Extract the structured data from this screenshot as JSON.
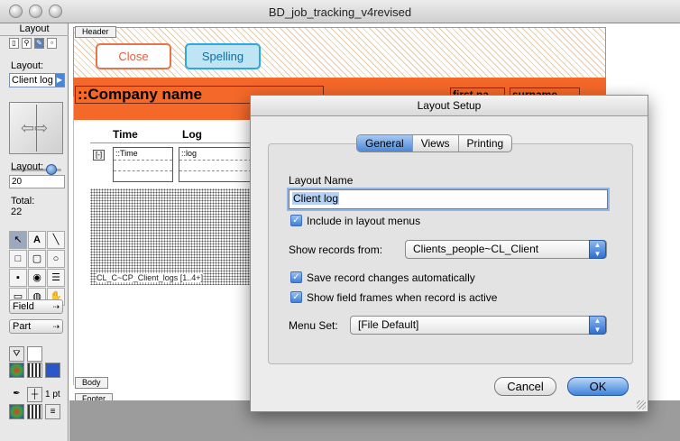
{
  "window": {
    "title": "BD_job_tracking_v4revised"
  },
  "palette": {
    "title": "Layout",
    "layout_label": "Layout:",
    "layout_popup": "Client log",
    "layout_num_label": "Layout:",
    "layout_num": "20",
    "total_label": "Total:",
    "total_value": "22",
    "field_button": "Field",
    "part_button": "Part",
    "line_width": "1 pt"
  },
  "canvas": {
    "header_tab": "Header",
    "body_tab": "Body",
    "footer_tab": "Footer",
    "close_button": "Close",
    "spelling_button": "Spelling",
    "company_field": "::Company name",
    "first_name_field": "first na",
    "surname_field": "surname",
    "col_time": "Time",
    "col_log": "Log",
    "portal_time": "::Time",
    "portal_log": "::log",
    "portal_minus": "[-]",
    "portal_label": "CL_C~CP_Client_logs [1..4+]"
  },
  "dialog": {
    "title": "Layout Setup",
    "tabs": [
      "General",
      "Views",
      "Printing"
    ],
    "layout_name_label": "Layout Name",
    "layout_name_value": "Client log",
    "include_menus_label": "Include in layout menus",
    "show_records_label": "Show records from:",
    "show_records_value": "Clients_people~CL_Client",
    "save_changes_label": "Save record changes automatically",
    "show_frames_label": "Show field frames when record is active",
    "menu_set_label": "Menu Set:",
    "menu_set_value": "[File Default]",
    "cancel_button": "Cancel",
    "ok_button": "OK"
  }
}
